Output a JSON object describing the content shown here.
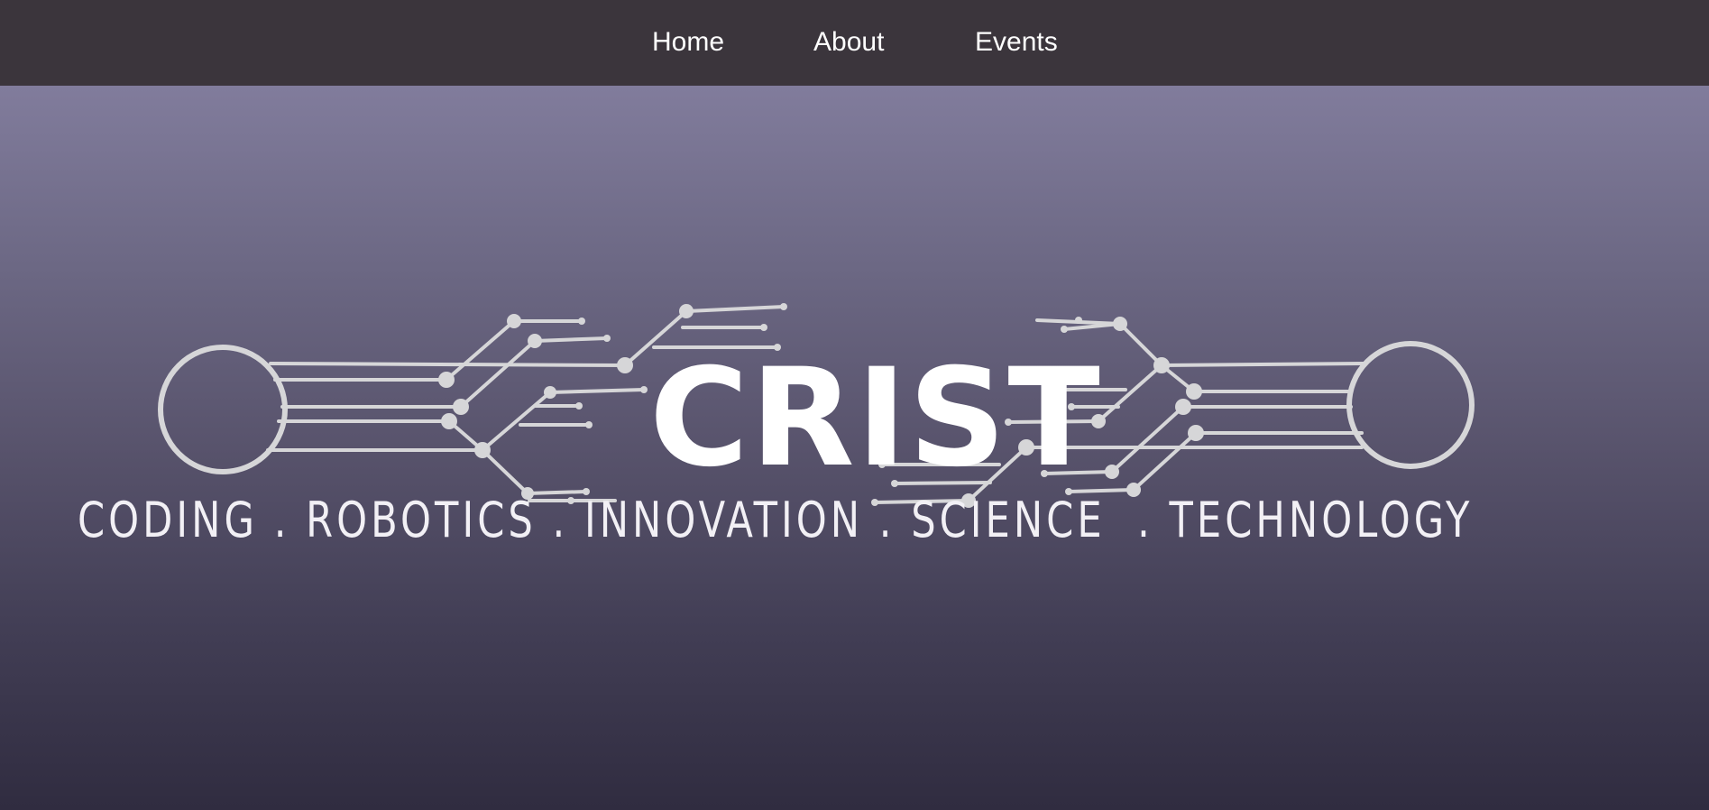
{
  "nav": {
    "items": [
      {
        "label": "Home"
      },
      {
        "label": "About"
      },
      {
        "label": "Events"
      }
    ]
  },
  "hero": {
    "logo": {
      "title": "CRIST",
      "tagline": "CODING . ROBOTICS . INNOVATION . SCIENCE  . TECHNOLOGY",
      "icon": "circuit-board-icon"
    }
  },
  "colors": {
    "navbar_background": "#3b353c",
    "hero_gradient_top": "#817c9c",
    "hero_gradient_bottom": "#302c40",
    "circuit_line": "#d6d6d8",
    "text": "#ffffff"
  }
}
